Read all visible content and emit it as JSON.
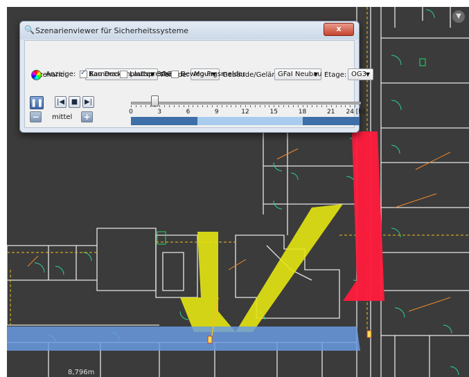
{
  "window": {
    "title": "Szenarienviewer für Sicherheitssysteme",
    "close_label": "x"
  },
  "controls": {
    "scenario_label": "Szenario:",
    "scenario_value": "Bau Deckenplatten 3OG",
    "period_label": "Periode:",
    "period_value": "Mo-Fr",
    "building_label": "Gebäude/Gelände:",
    "building_value": "GFaI Neubau",
    "floor_label": "Etage:",
    "floor_value": "OG3",
    "display_label": "Anzeige:",
    "checkboxes": [
      {
        "label": "Kameras",
        "checked": true
      },
      {
        "label": "Lautsprecher",
        "checked": false
      },
      {
        "label": "Bewegungsmelder",
        "checked": false
      }
    ],
    "speed_label": "mittel"
  },
  "timeline": {
    "tick_labels": [
      "0",
      "3",
      "6",
      "9",
      "12",
      "15",
      "18",
      "21",
      "24 [h]"
    ],
    "range_hours": [
      0,
      24
    ],
    "slider_hours": 2.5,
    "segments": [
      {
        "from": 0,
        "to": 7,
        "color": "#3e6fa8"
      },
      {
        "from": 7,
        "to": 18,
        "color": "#a9cbee"
      },
      {
        "from": 18,
        "to": 24,
        "color": "#3e6fa8"
      }
    ]
  },
  "map": {
    "scale_label": "8,796m",
    "colors": {
      "background": "#3b3b3b",
      "walls": "#e6e6e6",
      "camera_cone": "#e6e614",
      "red_zone": "#ff1a3c",
      "blue_zone": "#6a9be0"
    }
  },
  "icons": {
    "title": "search-icon",
    "color": "color-wheel-icon",
    "pause": "pause-icon",
    "skip_back": "skip-back-icon",
    "stop": "stop-icon",
    "skip_forward": "skip-forward-icon",
    "minus": "minus-icon",
    "plus": "plus-icon",
    "collapse": "chevron-down-icon"
  }
}
